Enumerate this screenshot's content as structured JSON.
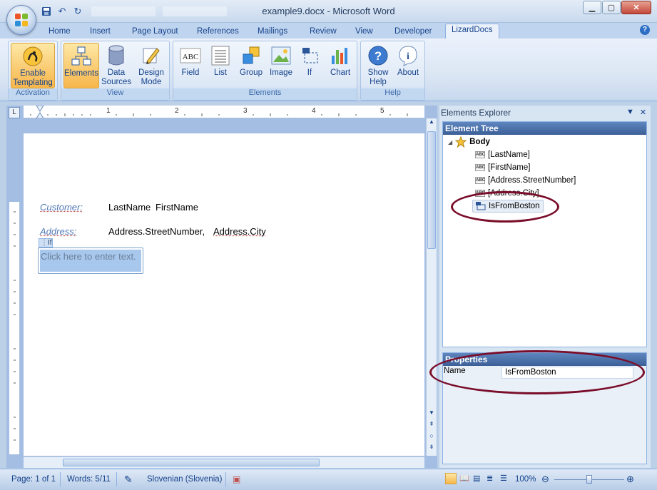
{
  "window": {
    "title": "example9.docx - Microsoft Word"
  },
  "tabs": [
    "Home",
    "Insert",
    "Page Layout",
    "References",
    "Mailings",
    "Review",
    "View",
    "Developer",
    "LizardDocs"
  ],
  "ribbon": {
    "groups": [
      {
        "label": "Activation",
        "buttons": [
          "Enable\nTemplating"
        ]
      },
      {
        "label": "View",
        "buttons": [
          "Elements",
          "Data\nSources",
          "Design\nMode"
        ]
      },
      {
        "label": "Elements",
        "buttons": [
          "Field",
          "List",
          "Group",
          "Image",
          "If",
          "Chart"
        ]
      },
      {
        "label": "Help",
        "buttons": [
          "Show\nHelp",
          "About"
        ]
      }
    ]
  },
  "document": {
    "customer_label": "Customer:",
    "address_label": "Address:",
    "last_name": "LastName",
    "first_name": "FirstName",
    "street_number": "Address.StreetNumber,",
    "city": "Address.City",
    "if_tag": "If",
    "placeholder": "Click here to enter text."
  },
  "explorer": {
    "title": "Elements Explorer",
    "tree_header": "Element Tree",
    "tree": [
      {
        "label": "Body",
        "icon": "star-icon"
      },
      {
        "label": "[LastName]",
        "icon": "abc-field-icon"
      },
      {
        "label": "[FirstName]",
        "icon": "abc-field-icon"
      },
      {
        "label": "[Address.StreetNumber]",
        "icon": "abc-field-icon"
      },
      {
        "label": "[Address.City]",
        "icon": "abc-field-icon"
      },
      {
        "label": "IsFromBoston",
        "icon": "if-element-icon",
        "selected": true
      }
    ],
    "properties_header": "Properties",
    "property_name": "Name",
    "property_value": "IsFromBoston"
  },
  "statusbar": {
    "page": "Page: 1 of 1",
    "words": "Words: 5/11",
    "language": "Slovenian (Slovenia)",
    "zoom": "100%"
  },
  "ruler_numbers": [
    "1",
    "2",
    "3",
    "4",
    "5"
  ],
  "colors": {
    "annotation": "#7a0d2a",
    "ribbon_accent": "#f7b64b",
    "panel_header": "#3c5f97"
  }
}
